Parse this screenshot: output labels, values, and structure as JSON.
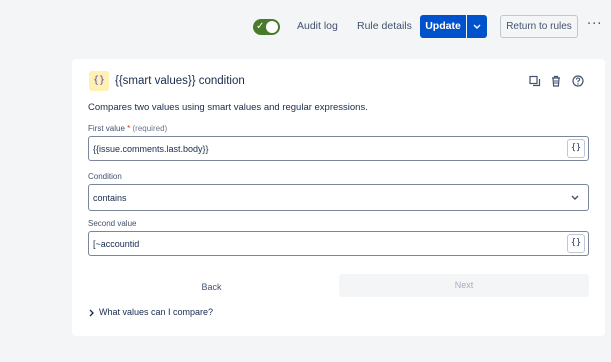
{
  "toolbar": {
    "toggle_enabled": true,
    "audit_log": "Audit log",
    "rule_details": "Rule details",
    "update": "Update",
    "return_to_rules": "Return to rules",
    "more": "···"
  },
  "card": {
    "icon_glyph": "{}",
    "title": "{{smart values}} condition",
    "description": "Compares two values using smart values and regular expressions.",
    "actions": [
      "duplicate-icon",
      "delete-icon",
      "help-icon"
    ],
    "first_value": {
      "label": "First value",
      "required_mark": "*",
      "required_text": "(required)",
      "value": "{{issue.comments.last.body}}",
      "smart_button": "{}"
    },
    "condition": {
      "label": "Condition",
      "value": "contains"
    },
    "second_value": {
      "label": "Second value",
      "value": "[~accountid",
      "smart_button": "{}"
    },
    "back": "Back",
    "next": "Next",
    "faq": "What values can I compare?"
  },
  "colors": {
    "primary": "#0052cc",
    "toggle_on": "#4a7a2c",
    "icon_bg": "#fff0b3"
  }
}
